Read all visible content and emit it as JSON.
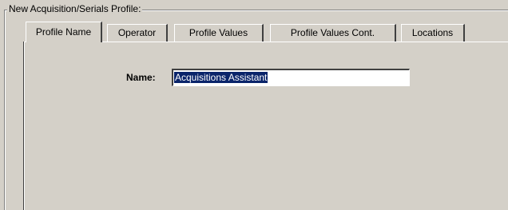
{
  "group": {
    "title": "New Acquisition/Serials Profile:"
  },
  "tabs": [
    {
      "label": "Profile Name",
      "active": true
    },
    {
      "label": "Operator",
      "active": false
    },
    {
      "label": "Profile Values",
      "active": false
    },
    {
      "label": "Profile Values Cont.",
      "active": false
    },
    {
      "label": "Locations",
      "active": false
    }
  ],
  "form": {
    "name_label": "Name:",
    "name_value": "Acquisitions Assistant"
  },
  "colors": {
    "background": "#d4d0c8",
    "selection": "#0a246a"
  }
}
